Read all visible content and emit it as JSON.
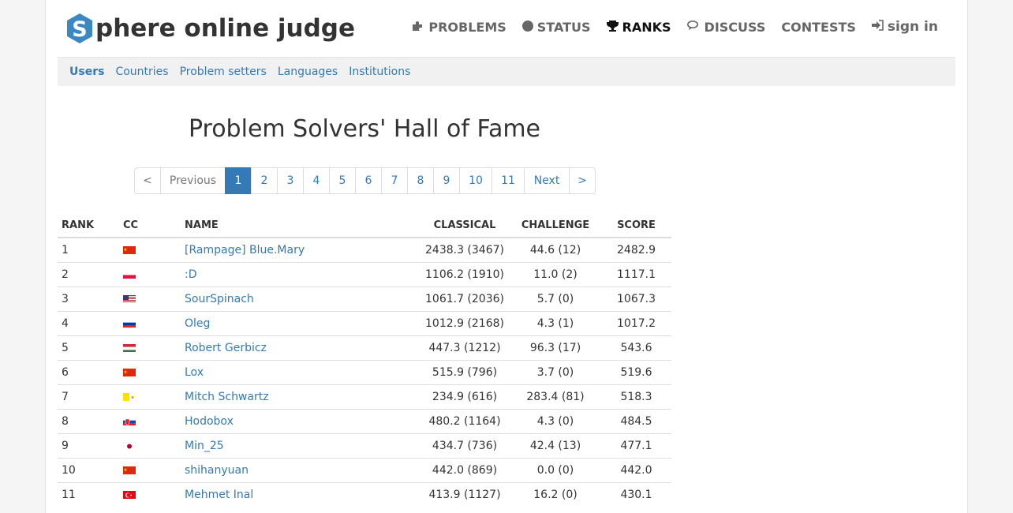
{
  "header": {
    "logo_letter": "S",
    "logo_text": "phere online judge",
    "nav": [
      {
        "label": "PROBLEMS",
        "icon": "puzzle-icon"
      },
      {
        "label": "STATUS",
        "icon": "circle-icon"
      },
      {
        "label": "RANKS",
        "icon": "trophy-icon"
      },
      {
        "label": "DISCUSS",
        "icon": "comments-icon"
      },
      {
        "label": "CONTESTS",
        "icon": ""
      },
      {
        "label": "sign in",
        "icon": "sign-in-icon"
      }
    ]
  },
  "subnav": [
    "Users",
    "Countries",
    "Problem setters",
    "Languages",
    "Institutions"
  ],
  "title": "Problem Solvers' Hall of Fame",
  "pagination": [
    "<",
    "Previous",
    "1",
    "2",
    "3",
    "4",
    "5",
    "6",
    "7",
    "8",
    "9",
    "10",
    "11",
    "Next",
    ">"
  ],
  "table": {
    "headers": [
      "RANK",
      "CC",
      "NAME",
      "CLASSICAL",
      "CHALLENGE",
      "SCORE"
    ],
    "rows": [
      {
        "rank": "1",
        "cc": "cn",
        "name": "[Rampage] Blue.Mary",
        "classical": "2438.3 (3467)",
        "challenge": "44.6 (12)",
        "score": "2482.9"
      },
      {
        "rank": "2",
        "cc": "pl",
        "name": ":D",
        "classical": "1106.2 (1910)",
        "challenge": "11.0 (2)",
        "score": "1117.1"
      },
      {
        "rank": "3",
        "cc": "us",
        "name": "SourSpinach",
        "classical": "1061.7 (2036)",
        "challenge": "5.7 (0)",
        "score": "1067.3"
      },
      {
        "rank": "4",
        "cc": "ru",
        "name": "Oleg",
        "classical": "1012.9 (2168)",
        "challenge": "4.3 (1)",
        "score": "1017.2"
      },
      {
        "rank": "5",
        "cc": "hu",
        "name": "Robert Gerbicz",
        "classical": "447.3 (1212)",
        "challenge": "96.3 (17)",
        "score": "543.6"
      },
      {
        "rank": "6",
        "cc": "cn",
        "name": "Lox",
        "classical": "515.9 (796)",
        "challenge": "3.7 (0)",
        "score": "519.6"
      },
      {
        "rank": "7",
        "cc": "va",
        "name": "Mitch Schwartz",
        "classical": "234.9 (616)",
        "challenge": "283.4 (81)",
        "score": "518.3"
      },
      {
        "rank": "8",
        "cc": "sk",
        "name": "Hodobox",
        "classical": "480.2 (1164)",
        "challenge": "4.3 (0)",
        "score": "484.5"
      },
      {
        "rank": "9",
        "cc": "jp",
        "name": "Min_25",
        "classical": "434.7 (736)",
        "challenge": "42.4 (13)",
        "score": "477.1"
      },
      {
        "rank": "10",
        "cc": "cn",
        "name": "shihanyuan",
        "classical": "442.0 (869)",
        "challenge": "0.0 (0)",
        "score": "442.0"
      },
      {
        "rank": "11",
        "cc": "tr",
        "name": "Mehmet Inal",
        "classical": "413.9 (1127)",
        "challenge": "16.2 (0)",
        "score": "430.1"
      }
    ]
  },
  "colors": {
    "link": "#337ab7",
    "logo_blue": "#3b88c3",
    "active_page": "#337ab7"
  }
}
